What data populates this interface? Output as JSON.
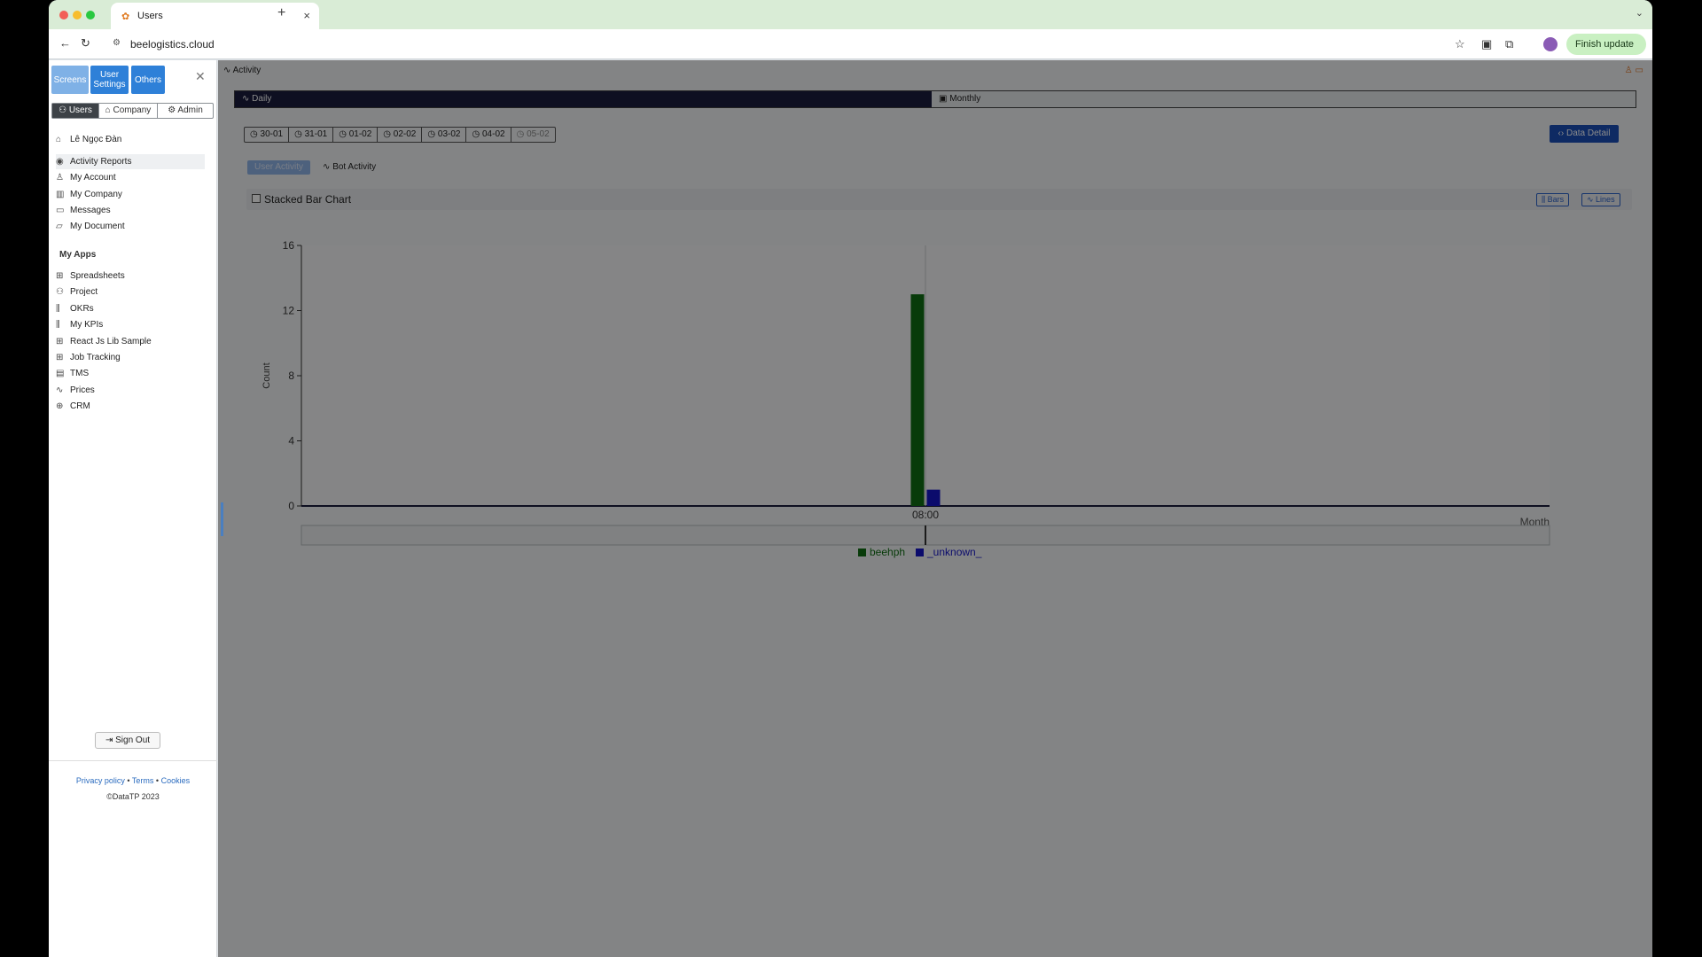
{
  "browser": {
    "tab_title": "Users",
    "url": "beelogistics.cloud",
    "finish_update": "Finish update"
  },
  "sidebar": {
    "top_buttons": [
      {
        "label": "Screens",
        "color": "#7fb1e6"
      },
      {
        "label": "User Settings",
        "color": "#2e80d8"
      },
      {
        "label": "Others",
        "color": "#2e80d8"
      }
    ],
    "role_tabs": [
      "Users",
      "Company",
      "Admin"
    ],
    "user_name": "Lê Ngọc Đàn",
    "account_items": [
      {
        "label": "Activity Reports",
        "icon": "eye-icon",
        "selected": true
      },
      {
        "label": "My Account",
        "icon": "user-icon"
      },
      {
        "label": "My Company",
        "icon": "building-icon"
      },
      {
        "label": "Messages",
        "icon": "message-icon"
      },
      {
        "label": "My Document",
        "icon": "folder-icon"
      }
    ],
    "apps_heading": "My Apps",
    "app_items": [
      {
        "label": "Spreadsheets",
        "icon": "grid-icon"
      },
      {
        "label": "Project",
        "icon": "users-icon"
      },
      {
        "label": "OKRs",
        "icon": "bar-chart-icon"
      },
      {
        "label": "My KPIs",
        "icon": "bar-chart-icon"
      },
      {
        "label": "React Js Lib Sample",
        "icon": "grid-icon"
      },
      {
        "label": "Job Tracking",
        "icon": "grid-icon"
      },
      {
        "label": "TMS",
        "icon": "document-icon"
      },
      {
        "label": "Prices",
        "icon": "activity-icon"
      },
      {
        "label": "CRM",
        "icon": "globe-icon"
      }
    ],
    "sign_out": "Sign Out",
    "footer_links": [
      "Privacy policy",
      "Terms",
      "Cookies"
    ],
    "copyright": "©DataTP 2023"
  },
  "main": {
    "page_title": "Activity",
    "period_tabs": [
      "Daily",
      "Monthly"
    ],
    "active_period": "Daily",
    "dates": [
      "30-01",
      "31-01",
      "01-02",
      "02-02",
      "03-02",
      "04-02",
      "05-02"
    ],
    "data_detail": "Data Detail",
    "sub_tabs": [
      "User Activity",
      "Bot Activity"
    ],
    "stacked_label": "Stacked Bar Chart",
    "mode_buttons": [
      "Bars",
      "Lines"
    ]
  },
  "chart_data": {
    "type": "bar",
    "categories": [
      "08:00"
    ],
    "series": [
      {
        "name": "beehph",
        "values": [
          13
        ],
        "color": "#0f6e14"
      },
      {
        "name": "_unknown_",
        "values": [
          1
        ],
        "color": "#1616c8"
      }
    ],
    "ylabel": "Count",
    "xlabel": "Month",
    "ylim": [
      0,
      16
    ],
    "yticks": [
      0,
      4,
      8,
      12,
      16
    ]
  }
}
